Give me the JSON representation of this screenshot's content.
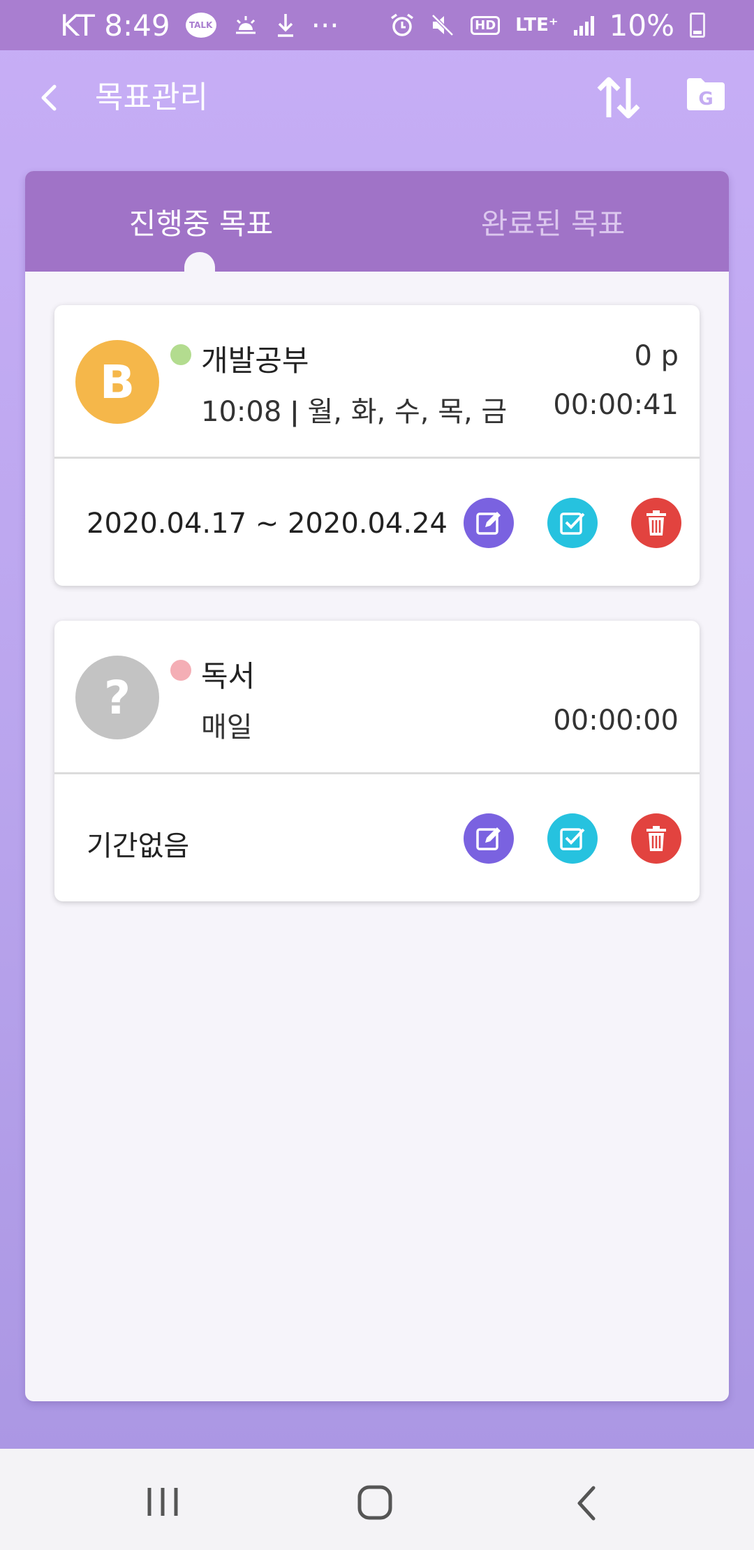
{
  "status_bar": {
    "carrier_time": "KT 8:49",
    "talk_label": "TALK",
    "more": "···",
    "hd_label": "HD",
    "network": "LTE⁺",
    "battery": "10%"
  },
  "app_bar": {
    "title": "목표관리"
  },
  "tabs": [
    {
      "label": "진행중 목표",
      "active": true
    },
    {
      "label": "완료된 목표",
      "active": false
    }
  ],
  "goals": [
    {
      "avatar_letter": "B",
      "avatar_color": "#f5b74a",
      "dot_color": "#b3dc8f",
      "name": "개발공부",
      "points": "0 p",
      "schedule": "10:08 ǀ 월, 화, 수, 목, 금",
      "elapsed": "00:00:41",
      "period": "2020.04.17 ~ 2020.04.24"
    },
    {
      "avatar_letter": "?",
      "avatar_color": "#c3c3c3",
      "dot_color": "#f4aeb5",
      "name": "독서",
      "points": "",
      "schedule": "매일",
      "elapsed": "00:00:00",
      "period": "기간없음"
    }
  ],
  "colors": {
    "accent": "#a073c7",
    "edit": "#7a62e0",
    "check": "#26c2df",
    "delete": "#e2433f"
  },
  "icons": [
    "back-arrow-icon",
    "sort-icon",
    "google-drive-folder-icon",
    "edit-icon",
    "check-icon",
    "trash-icon"
  ]
}
